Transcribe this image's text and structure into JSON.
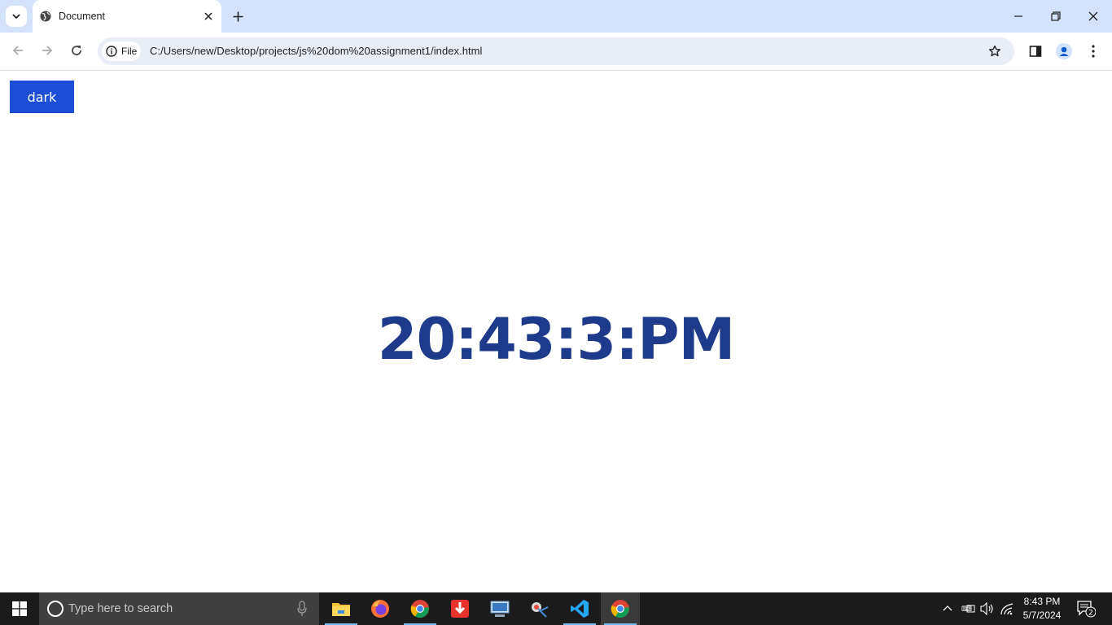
{
  "browser": {
    "tab": {
      "title": "Document"
    },
    "address": {
      "chip_label": "File",
      "url": "C:/Users/new/Desktop/projects/js%20dom%20assignment1/index.html"
    }
  },
  "page": {
    "theme_button_label": "dark",
    "clock_text": "20:43:3:PM",
    "colors": {
      "button": "#1d4ed8",
      "clock": "#1e3a8a"
    }
  },
  "taskbar": {
    "search_placeholder": "Type here to search",
    "apps": [
      "file-explorer",
      "firefox",
      "chrome",
      "download-manager",
      "control-panel",
      "snipping-tool",
      "vscode",
      "chrome-active"
    ],
    "time": "8:43 PM",
    "date": "5/7/2024",
    "notification_count": "2"
  }
}
